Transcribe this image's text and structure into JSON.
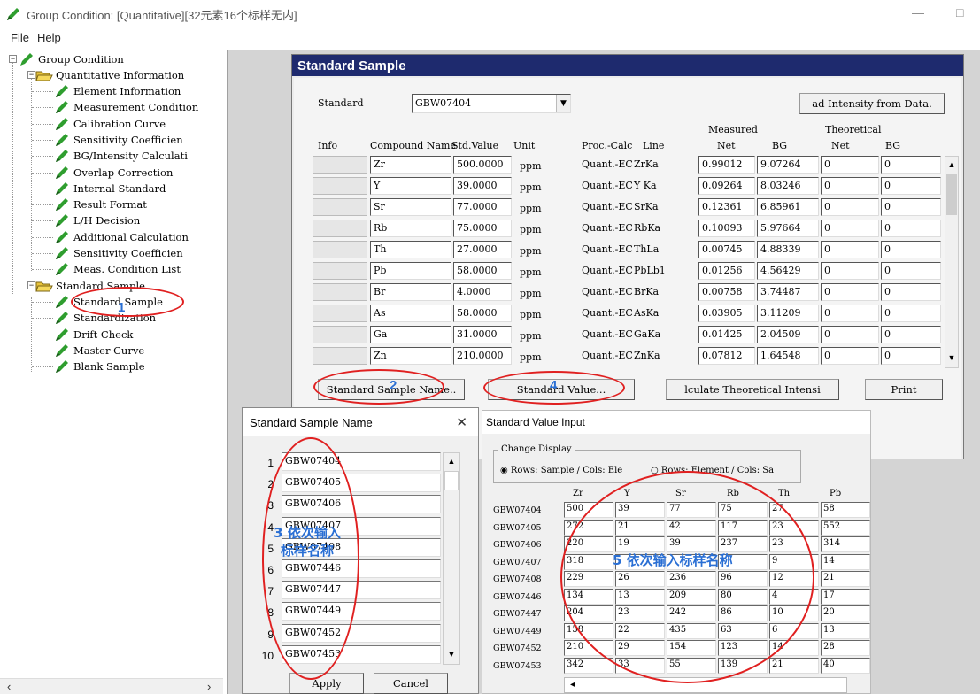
{
  "window": {
    "title": "Group Condition: [Quantitative][32元素16个标样无内]",
    "minimize": "—",
    "maximize": "□"
  },
  "menu": {
    "file": "File",
    "help": "Help"
  },
  "tree": {
    "root": "Group Condition",
    "quant": "Quantitative Information",
    "quant_items": [
      "Element Information",
      "Measurement Condition",
      "Calibration Curve",
      "Sensitivity Coefficien",
      "BG/Intensity Calculati",
      "Overlap Correction",
      "Internal Standard",
      "Result Format",
      "L/H Decision",
      "Additional Calculation",
      "Sensitivity Coefficien",
      "Meas. Condition List"
    ],
    "std": "Standard Sample",
    "std_items": [
      "Standard Sample",
      "Standardization",
      "Drift Check",
      "Master Curve",
      "Blank Sample"
    ]
  },
  "panel": {
    "header": "Standard Sample",
    "standard_label": "Standard",
    "standard_value": "GBW07404",
    "read_btn": "ad Intensity from Data.",
    "measured": "Measured",
    "theoretical": "Theoretical",
    "cols": {
      "info": "Info",
      "compound": "Compound Name",
      "std": "Std.Value",
      "unit": "Unit",
      "proc": "Proc.-Calc",
      "line": "Line",
      "net1": "Net",
      "bg1": "BG",
      "net2": "Net",
      "bg2": "BG"
    },
    "rows": [
      {
        "c": "Zr",
        "v": "500.0000",
        "u": "ppm",
        "p": "Quant.-EC",
        "l": "ZrKa",
        "n": "0.99012",
        "b": "9.07264",
        "tn": "0",
        "tb": "0"
      },
      {
        "c": "Y",
        "v": "39.0000",
        "u": "ppm",
        "p": "Quant.-EC",
        "l": "Y Ka",
        "n": "0.09264",
        "b": "8.03246",
        "tn": "0",
        "tb": "0"
      },
      {
        "c": "Sr",
        "v": "77.0000",
        "u": "ppm",
        "p": "Quant.-EC",
        "l": "SrKa",
        "n": "0.12361",
        "b": "6.85961",
        "tn": "0",
        "tb": "0"
      },
      {
        "c": "Rb",
        "v": "75.0000",
        "u": "ppm",
        "p": "Quant.-EC",
        "l": "RbKa",
        "n": "0.10093",
        "b": "5.97664",
        "tn": "0",
        "tb": "0"
      },
      {
        "c": "Th",
        "v": "27.0000",
        "u": "ppm",
        "p": "Quant.-EC",
        "l": "ThLa",
        "n": "0.00745",
        "b": "4.88339",
        "tn": "0",
        "tb": "0"
      },
      {
        "c": "Pb",
        "v": "58.0000",
        "u": "ppm",
        "p": "Quant.-EC",
        "l": "PbLb1",
        "n": "0.01256",
        "b": "4.56429",
        "tn": "0",
        "tb": "0"
      },
      {
        "c": "Br",
        "v": "4.0000",
        "u": "ppm",
        "p": "Quant.-EC",
        "l": "BrKa",
        "n": "0.00758",
        "b": "3.74487",
        "tn": "0",
        "tb": "0"
      },
      {
        "c": "As",
        "v": "58.0000",
        "u": "ppm",
        "p": "Quant.-EC",
        "l": "AsKa",
        "n": "0.03905",
        "b": "3.11209",
        "tn": "0",
        "tb": "0"
      },
      {
        "c": "Ga",
        "v": "31.0000",
        "u": "ppm",
        "p": "Quant.-EC",
        "l": "GaKa",
        "n": "0.01425",
        "b": "2.04509",
        "tn": "0",
        "tb": "0"
      },
      {
        "c": "Zn",
        "v": "210.0000",
        "u": "ppm",
        "p": "Quant.-EC",
        "l": "ZnKa",
        "n": "0.07812",
        "b": "1.64548",
        "tn": "0",
        "tb": "0"
      }
    ],
    "btn_name": "Standard Sample Name..",
    "btn_value": "Standard Value...",
    "btn_calc": "lculate Theoretical Intensi",
    "btn_print": "Print"
  },
  "ssn": {
    "title": "Standard Sample Name",
    "close": "✕",
    "rows": [
      {
        "n": "1",
        "v": "GBW07404"
      },
      {
        "n": "2",
        "v": "GBW07405"
      },
      {
        "n": "3",
        "v": "GBW07406"
      },
      {
        "n": "4",
        "v": "GBW07407"
      },
      {
        "n": "5",
        "v": "GBW07408"
      },
      {
        "n": "6",
        "v": "GBW07446"
      },
      {
        "n": "7",
        "v": "GBW07447"
      },
      {
        "n": "8",
        "v": "GBW07449"
      },
      {
        "n": "9",
        "v": "GBW07452"
      },
      {
        "n": "10",
        "v": "GBW07453"
      }
    ],
    "apply": "Apply",
    "cancel": "Cancel"
  },
  "svi": {
    "title": "Standard Value Input",
    "group": "Change Display",
    "opt1": "Rows: Sample / Cols: Ele",
    "opt2": "Rows: Element / Cols: Sa",
    "cols": [
      "Zr",
      "Y",
      "Sr",
      "Rb",
      "Th",
      "Pb"
    ],
    "rows": [
      {
        "s": "GBW07404",
        "v": [
          "500",
          "39",
          "77",
          "75",
          "27",
          "58"
        ]
      },
      {
        "s": "GBW07405",
        "v": [
          "272",
          "21",
          "42",
          "117",
          "23",
          "552"
        ]
      },
      {
        "s": "GBW07406",
        "v": [
          "220",
          "19",
          "39",
          "237",
          "23",
          "314"
        ]
      },
      {
        "s": "GBW07407",
        "v": [
          "318",
          "",
          "",
          "",
          "9",
          "14"
        ]
      },
      {
        "s": "GBW07408",
        "v": [
          "229",
          "26",
          "236",
          "96",
          "12",
          "21"
        ]
      },
      {
        "s": "GBW07446",
        "v": [
          "134",
          "13",
          "209",
          "80",
          "4",
          "17"
        ]
      },
      {
        "s": "GBW07447",
        "v": [
          "204",
          "23",
          "242",
          "86",
          "10",
          "20"
        ]
      },
      {
        "s": "GBW07449",
        "v": [
          "158",
          "22",
          "435",
          "63",
          "6",
          "13"
        ]
      },
      {
        "s": "GBW07452",
        "v": [
          "210",
          "29",
          "154",
          "123",
          "14",
          "28"
        ]
      },
      {
        "s": "GBW07453",
        "v": [
          "342",
          "33",
          "55",
          "139",
          "21",
          "40"
        ]
      }
    ]
  },
  "annotations": {
    "n1": "1",
    "n2": "2",
    "n4": "4",
    "n3": "3 依次输入标样名称",
    "n5": "5 依次输入标样名称"
  },
  "colors": {
    "header": "#1e2a6e",
    "annotation_ring": "#e02020",
    "annotation_text": "#2a6fd4"
  }
}
